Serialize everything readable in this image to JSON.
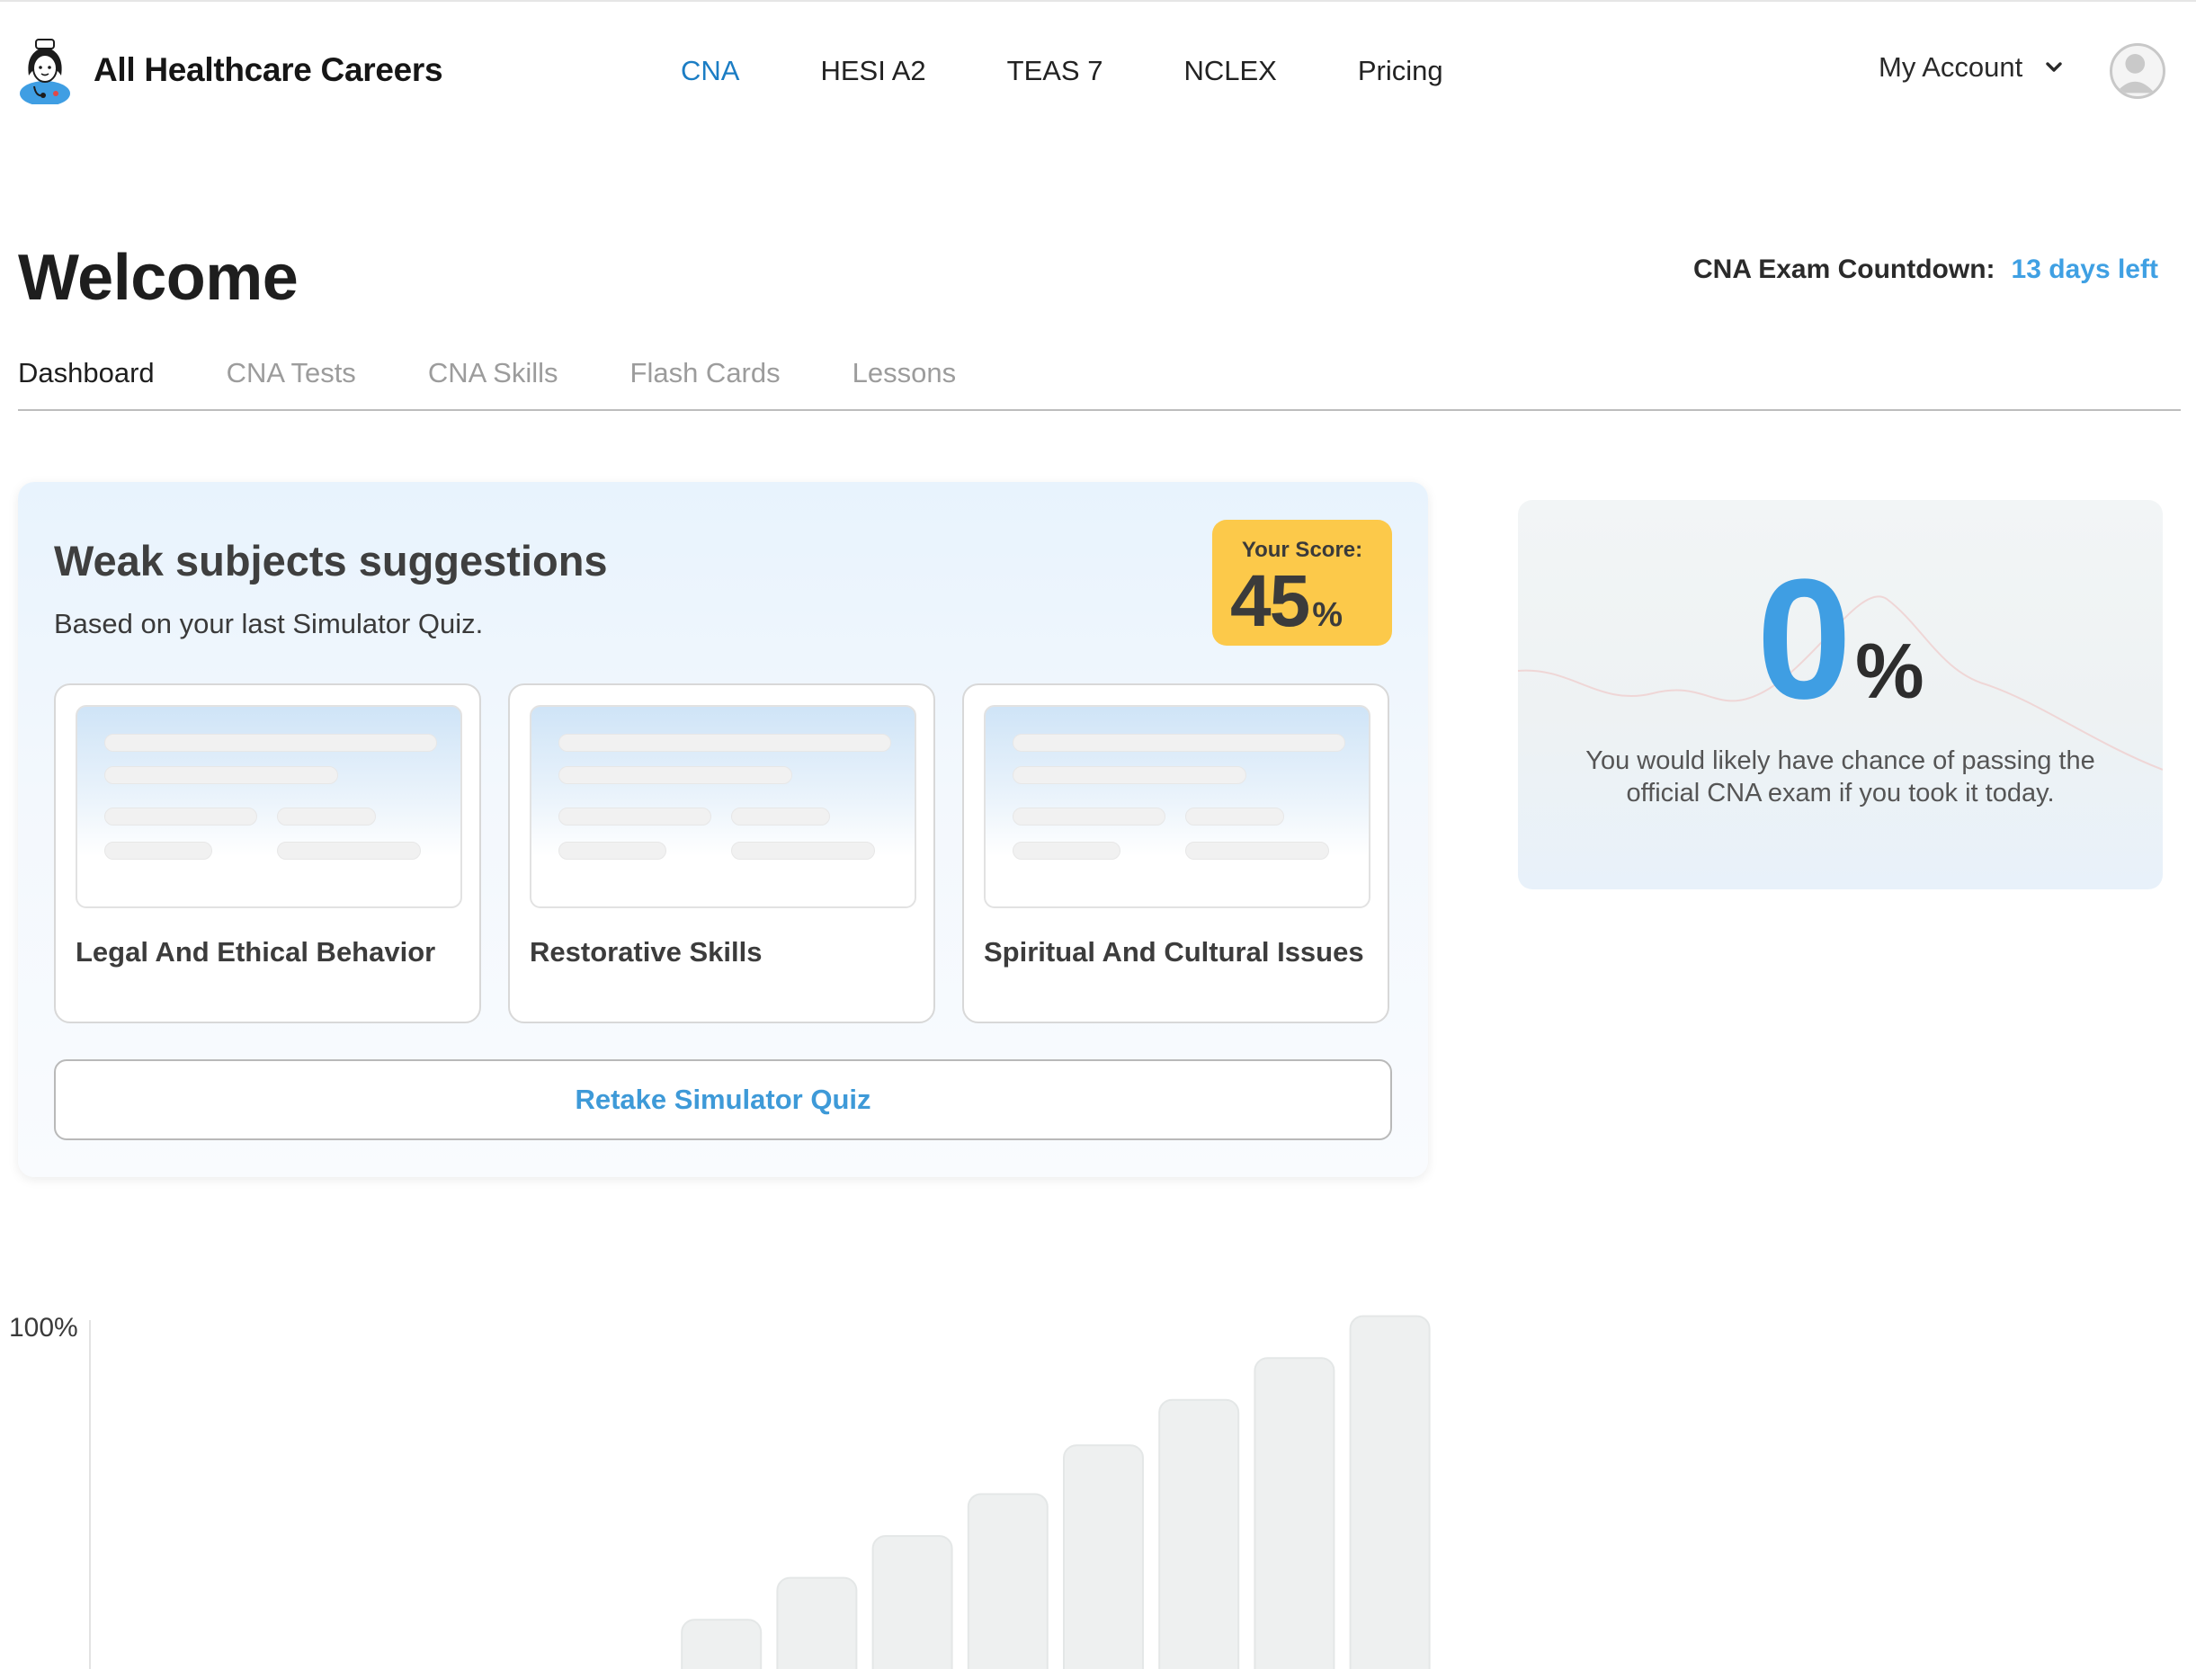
{
  "brand": {
    "name": "All Healthcare Careers"
  },
  "nav": {
    "items": [
      {
        "label": "CNA",
        "active": true
      },
      {
        "label": "HESI A2",
        "active": false
      },
      {
        "label": "TEAS 7",
        "active": false
      },
      {
        "label": "NCLEX",
        "active": false
      },
      {
        "label": "Pricing",
        "active": false
      }
    ]
  },
  "account": {
    "label": "My Account"
  },
  "page": {
    "title": "Welcome",
    "countdown_label": "CNA Exam Countdown:",
    "countdown_value": "13 days left"
  },
  "tabs": [
    {
      "label": "Dashboard",
      "active": true
    },
    {
      "label": "CNA Tests",
      "active": false
    },
    {
      "label": "CNA Skills",
      "active": false
    },
    {
      "label": "Flash Cards",
      "active": false
    },
    {
      "label": "Lessons",
      "active": false
    }
  ],
  "weak_subjects": {
    "title": "Weak subjects suggestions",
    "subtitle": "Based on your last Simulator Quiz.",
    "score_label": "Your Score:",
    "score_value": "45",
    "score_unit": "%",
    "items": [
      {
        "name": "Legal And Ethical Behavior"
      },
      {
        "name": "Restorative Skills"
      },
      {
        "name": "Spiritual And Cultural Issues"
      }
    ],
    "retake_label": "Retake Simulator Quiz"
  },
  "pass_chance": {
    "value": "0",
    "unit": "%",
    "text": "You would likely have chance of passing the official CNA exam if you took it today."
  },
  "colors": {
    "accent": "#3fa0e3",
    "nav_active": "#1b7dc4",
    "score_badge": "#fcc94a",
    "bar_fill": "#eef0f0"
  },
  "chart_data": {
    "type": "bar",
    "y_tick_labels": [
      "100%"
    ],
    "ylim": [
      0,
      100
    ],
    "values": [
      0,
      0,
      0,
      0,
      0,
      0,
      10,
      22,
      34,
      46,
      60,
      73,
      85,
      97
    ]
  }
}
